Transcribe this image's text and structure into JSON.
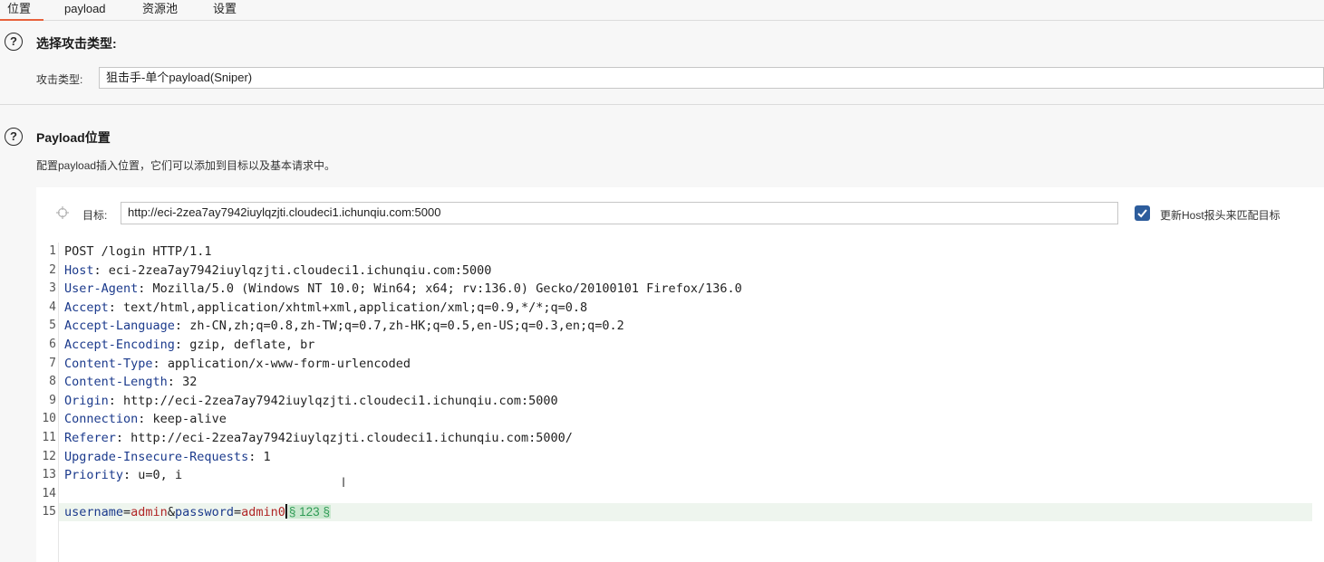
{
  "tabs": [
    "位置",
    "payload",
    "资源池",
    "设置"
  ],
  "attack_section": {
    "help_glyph": "?",
    "title": "选择攻击类型:",
    "type_label": "攻击类型:",
    "type_value": "狙击手-单个payload(Sniper)"
  },
  "payload_section": {
    "help_glyph": "?",
    "title": "Payload位置",
    "description": "配置payload插入位置，它们可以添加到目标以及基本请求中。",
    "target_label": "目标:",
    "target_value": "http://eci-2zea7ay7942iuylqzjti.cloudeci1.ichunqiu.com:5000",
    "update_host_checked": true,
    "update_host_label": "更新Host报头来匹配目标"
  },
  "request_lines": [
    {
      "n": "1",
      "text": "POST /login HTTP/1.1"
    },
    {
      "n": "2",
      "key": "Host",
      "val": " eci-2zea7ay7942iuylqzjti.cloudeci1.ichunqiu.com:5000"
    },
    {
      "n": "3",
      "key": "User-Agent",
      "val": " Mozilla/5.0 (Windows NT 10.0; Win64; x64; rv:136.0) Gecko/20100101 Firefox/136.0"
    },
    {
      "n": "4",
      "key": "Accept",
      "val": " text/html,application/xhtml+xml,application/xml;q=0.9,*/*;q=0.8"
    },
    {
      "n": "5",
      "key": "Accept-Language",
      "val": " zh-CN,zh;q=0.8,zh-TW;q=0.7,zh-HK;q=0.5,en-US;q=0.3,en;q=0.2"
    },
    {
      "n": "6",
      "key": "Accept-Encoding",
      "val": " gzip, deflate, br"
    },
    {
      "n": "7",
      "key": "Content-Type",
      "val": " application/x-www-form-urlencoded"
    },
    {
      "n": "8",
      "key": "Content-Length",
      "val": " 32"
    },
    {
      "n": "9",
      "key": "Origin",
      "val": " http://eci-2zea7ay7942iuylqzjti.cloudeci1.ichunqiu.com:5000"
    },
    {
      "n": "10",
      "key": "Connection",
      "val": " keep-alive"
    },
    {
      "n": "11",
      "key": "Referer",
      "val": " http://eci-2zea7ay7942iuylqzjti.cloudeci1.ichunqiu.com:5000/"
    },
    {
      "n": "12",
      "key": "Upgrade-Insecure-Requests",
      "val": " 1"
    },
    {
      "n": "13",
      "key": "Priority",
      "val": " u=0, i"
    },
    {
      "n": "14",
      "text": ""
    },
    {
      "n": "15",
      "body": true
    }
  ],
  "body_line": {
    "p1_key": "username",
    "eq1": "=",
    "p1_val": "admin",
    "amp": "&",
    "p2_key": "password",
    "eq2": "=",
    "p2_val": "admin0",
    "marker_text": "§ 123 §"
  },
  "colors": {
    "accent": "#e8613c",
    "checkbox": "#2d5d9c",
    "header_key": "#1b3a8c",
    "param_value": "#b02626",
    "payload_marker_bg": "#cbe8d0",
    "payload_marker_fg": "#2f9b55"
  },
  "icons": {
    "help": "question-circle-icon",
    "target": "crosshair-icon",
    "checkbox": "checkmark-icon",
    "cursor": "text-cursor-icon"
  }
}
